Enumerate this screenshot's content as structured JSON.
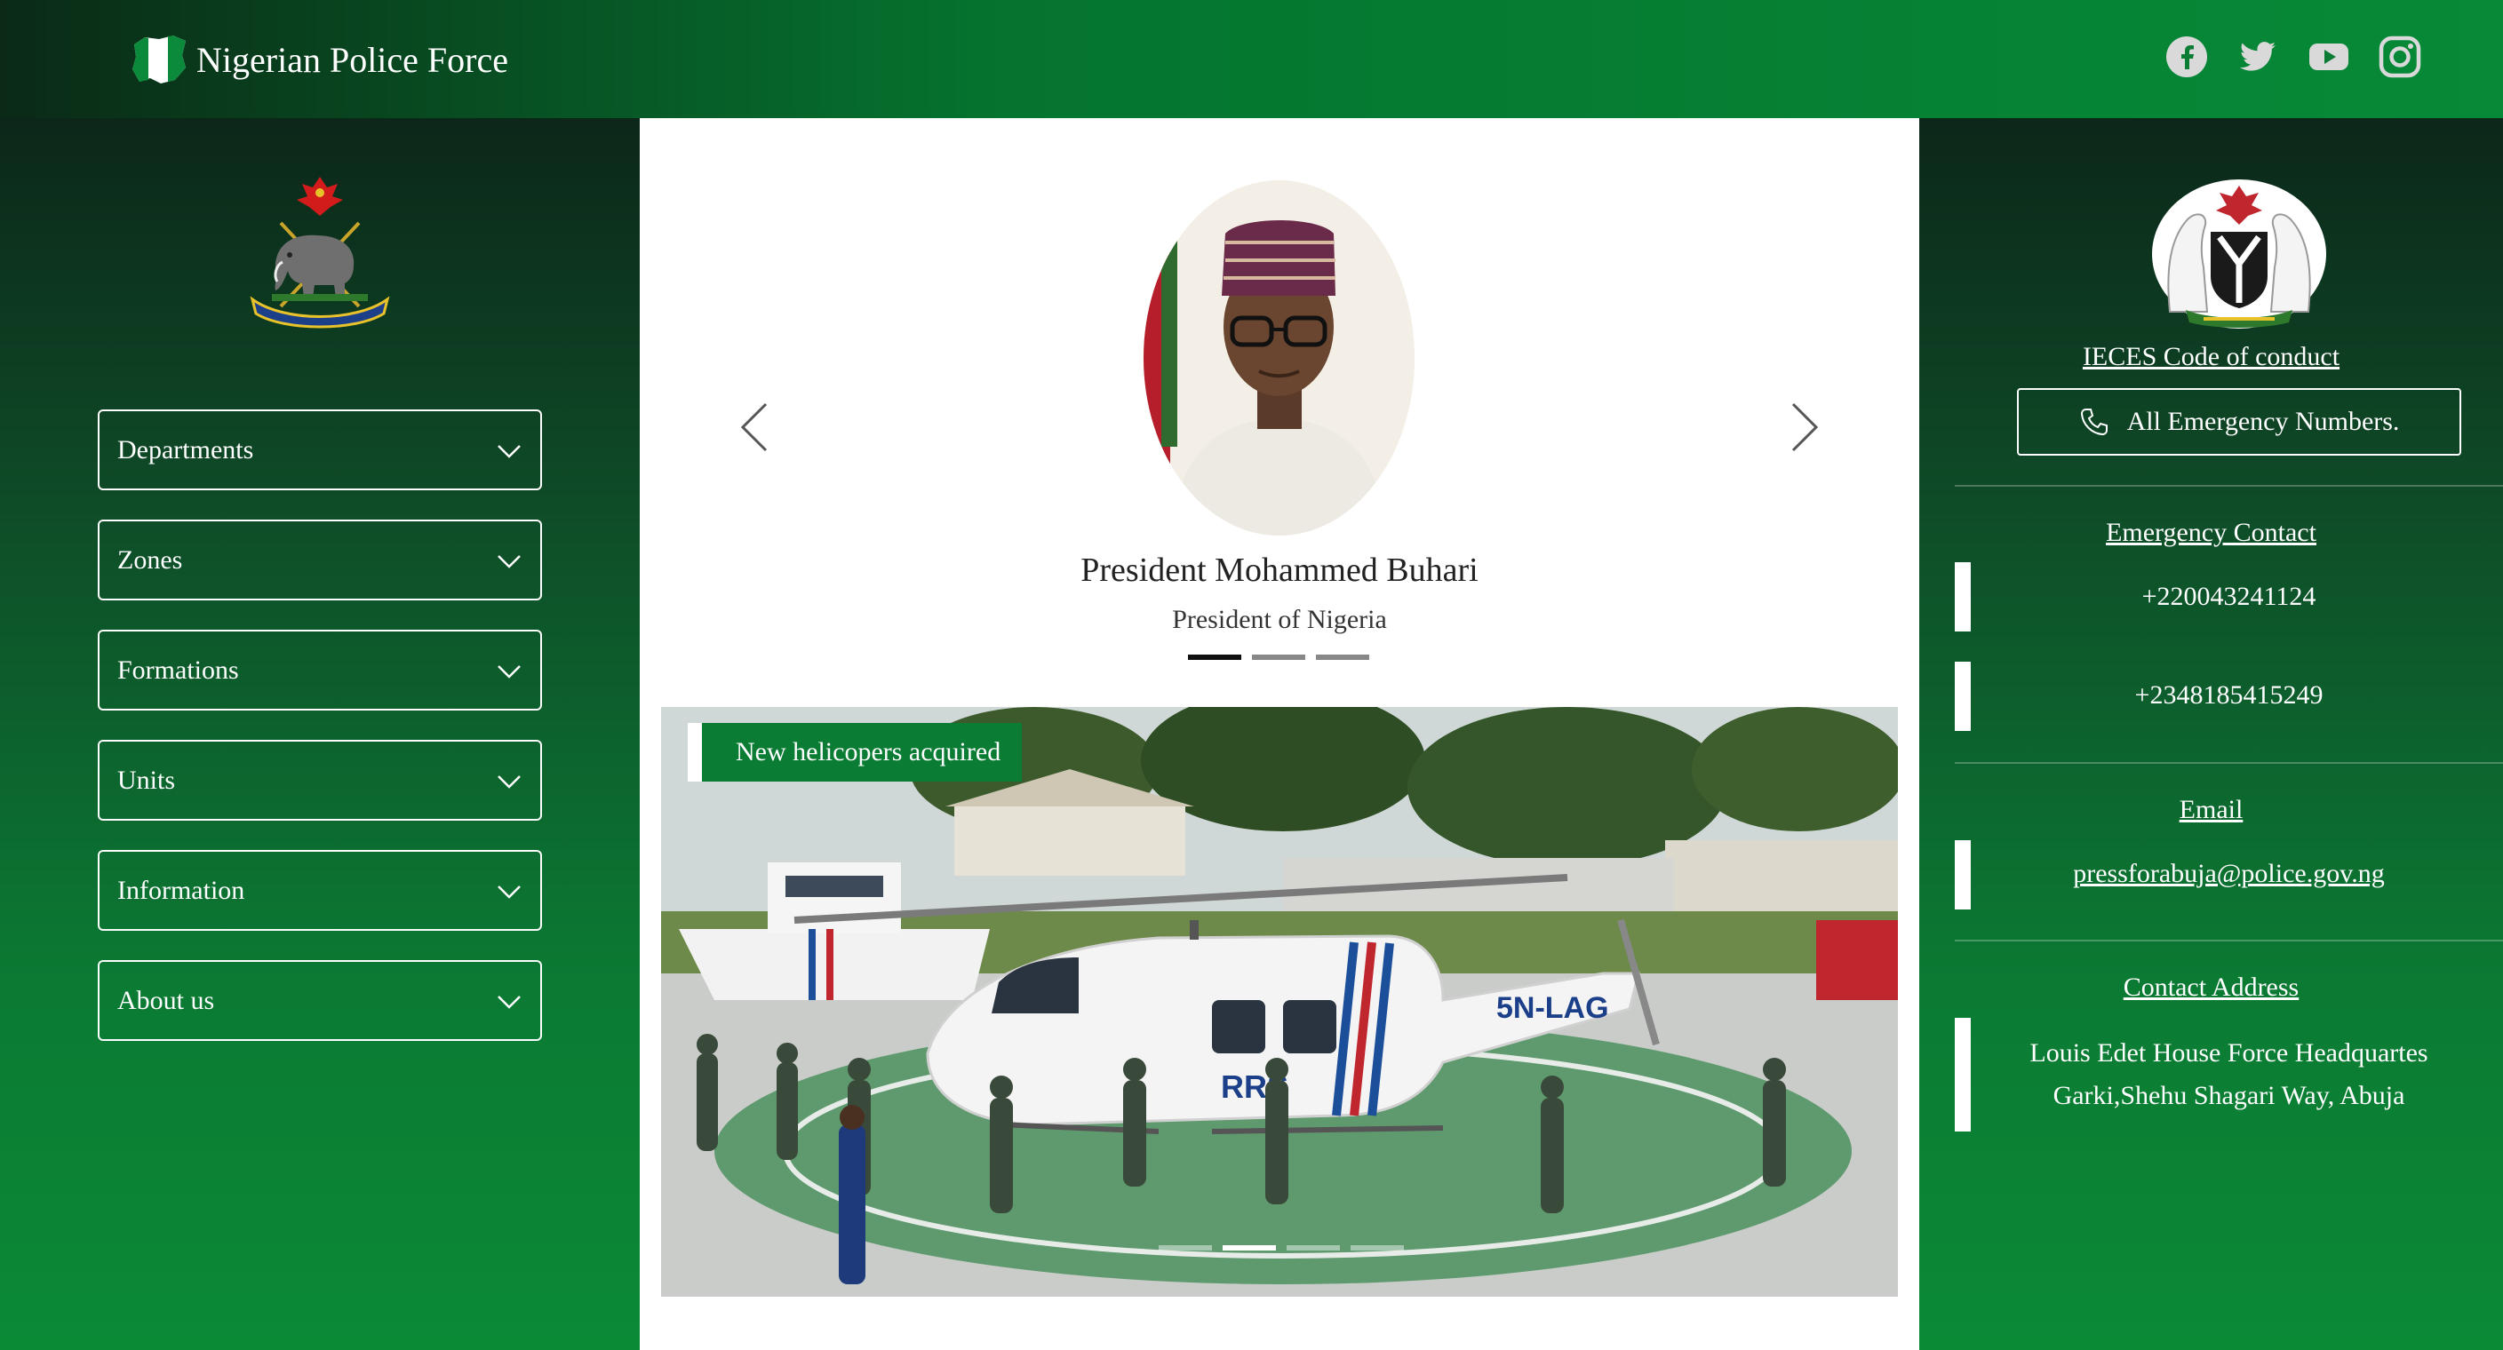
{
  "header": {
    "site_name": "Nigerian Police Force",
    "social_icons": [
      "facebook-icon",
      "twitter-icon",
      "youtube-icon",
      "instagram-icon"
    ]
  },
  "sidebar": {
    "items": [
      {
        "label": "Departments"
      },
      {
        "label": "Zones"
      },
      {
        "label": "Formations"
      },
      {
        "label": "Units"
      },
      {
        "label": "Information"
      },
      {
        "label": "About us"
      }
    ]
  },
  "carousel": {
    "person_name": "President Mohammed Buhari",
    "person_role": "President of Nigeria",
    "slide_count": 3,
    "active_slide": 1
  },
  "news": {
    "caption": "New helicopers acquired",
    "slide_count": 4,
    "active_slide": 2,
    "tail_number": "5N-LAG",
    "livery_text": "RRS"
  },
  "contact": {
    "conduct_link": "IECES Code of conduct",
    "emergency_button": "All Emergency Numbers.",
    "emergency_title": "Emergency Contact",
    "phone_1": "+220043241124",
    "phone_2": "+2348185415249",
    "email_title": "Email",
    "email": "pressforabuja@police.gov.ng",
    "address_title": "Contact Address",
    "address_line_1": "Louis Edet House Force Headquartes",
    "address_line_2": "Garki,Shehu Shagari Way, Abuja"
  },
  "colors": {
    "brand_green": "#0a7c34",
    "dark_green": "#0c2719",
    "white": "#ffffff"
  }
}
